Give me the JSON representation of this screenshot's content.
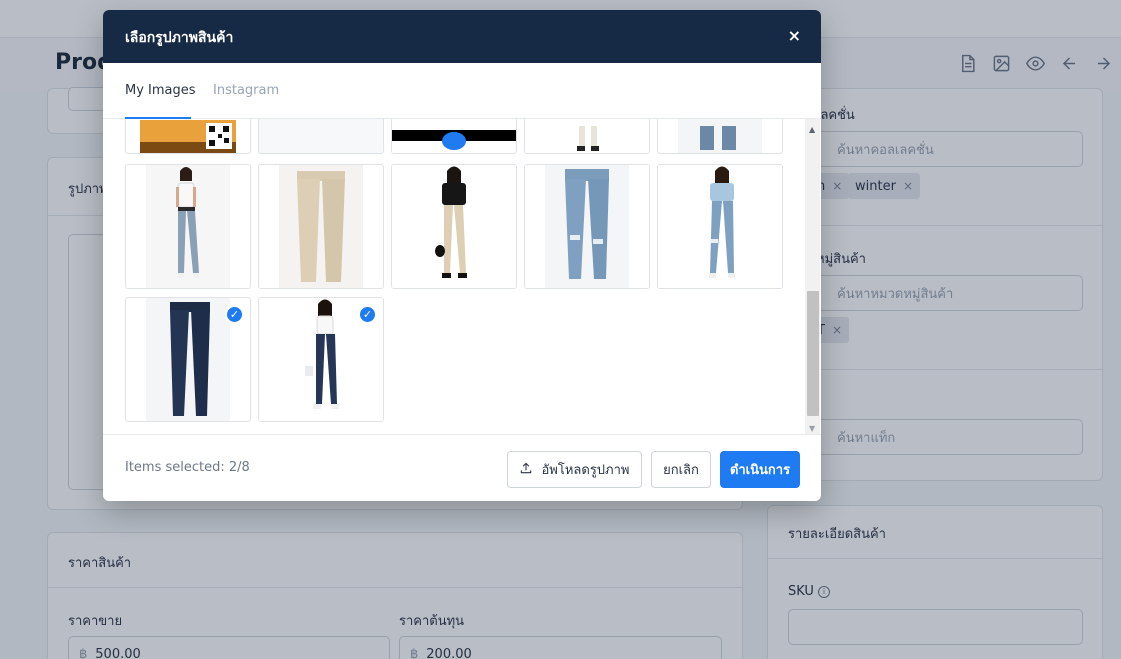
{
  "background": {
    "page_title": "Prod",
    "header_icons": [
      "document-icon",
      "image-icon",
      "eye-icon",
      "arrow-left-icon",
      "arrow-right-icon"
    ],
    "images_card_title": "รูปภาพ",
    "collection": {
      "label": "เลคชั่น",
      "placeholder": "ค้นหาคอลเลคชั่น",
      "tags": [
        "n",
        "winter"
      ]
    },
    "category": {
      "label": "หมู่สินค้า",
      "placeholder": "ค้นหาหมวดหมู่สินค้า",
      "tags": [
        "T"
      ]
    },
    "tags_field": {
      "placeholder": "ค้นหาแท็ก"
    },
    "price_card": {
      "title": "ราคาสินค้า",
      "sell_label": "ราคาขาย",
      "sell_currency": "฿",
      "sell_value": "500.00",
      "cost_label": "ราคาต้นทุน",
      "cost_currency": "฿",
      "cost_value": "200.00"
    },
    "details_card": {
      "title": "รายละเอียดสินค้า",
      "sku_label": "SKU"
    }
  },
  "modal": {
    "title": "เลือกรูปภาพสินค้า",
    "close_label": "×",
    "tabs": [
      {
        "label": "My Images",
        "active": true
      },
      {
        "label": "Instagram",
        "active": false
      }
    ],
    "images": [
      {
        "row": "partial",
        "subject": "qr-banner",
        "selected": false
      },
      {
        "row": "partial",
        "subject": "blank",
        "selected": false
      },
      {
        "row": "partial",
        "subject": "black-banner",
        "selected": false
      },
      {
        "row": "partial",
        "subject": "model-legs",
        "selected": false
      },
      {
        "row": "partial",
        "subject": "jeans-hem",
        "selected": false
      },
      {
        "row": "full",
        "subject": "model-white-top-grey-jeans",
        "selected": false
      },
      {
        "row": "full",
        "subject": "beige-trousers",
        "selected": false
      },
      {
        "row": "full",
        "subject": "model-black-shirt-beige-pants",
        "selected": false
      },
      {
        "row": "full",
        "subject": "ripped-blue-jeans",
        "selected": false
      },
      {
        "row": "full",
        "subject": "model-blue-top-ripped-jeans",
        "selected": false
      },
      {
        "row": "full",
        "subject": "dark-navy-jeans",
        "selected": true
      },
      {
        "row": "full",
        "subject": "model-white-top-navy-jeans",
        "selected": true
      }
    ],
    "items_selected": "Items selected: 2/8",
    "upload_label": "อัพโหลดรูปภาพ",
    "cancel_label": "ยกเลิก",
    "submit_label": "ดำเนินการ",
    "accent_color": "#1f7bf2",
    "header_color": "#172a45"
  }
}
